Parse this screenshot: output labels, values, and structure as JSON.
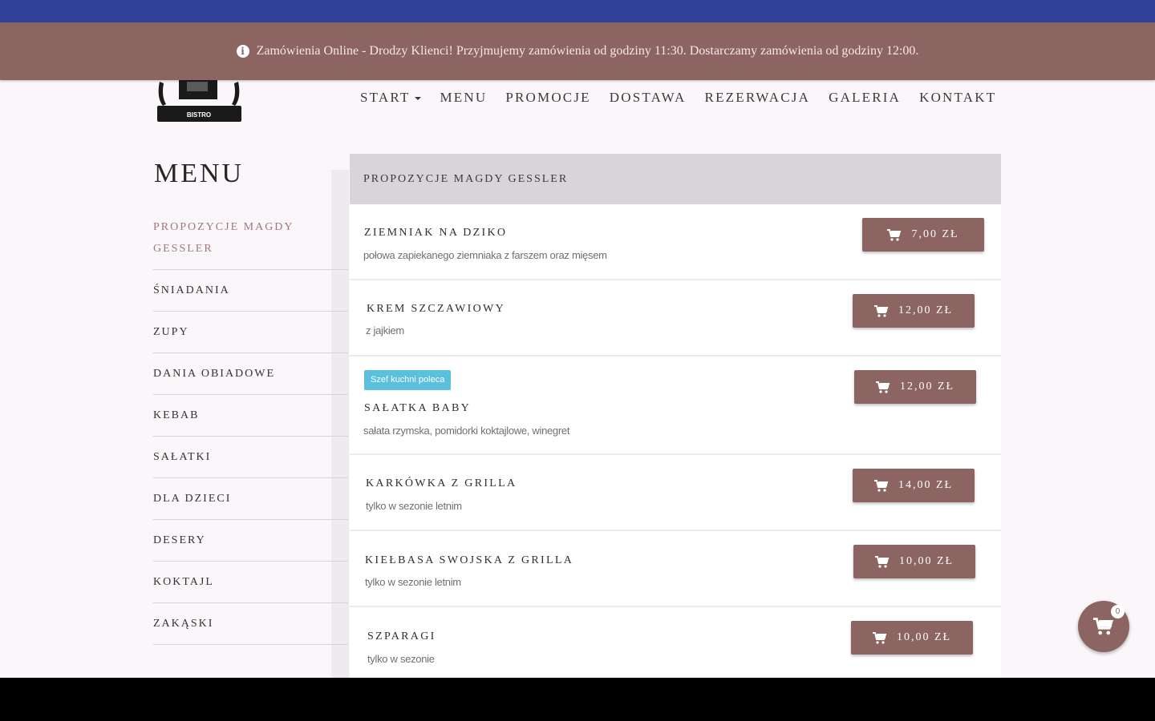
{
  "notice": {
    "text": "Zamówienia Online - Drodzy Klienci! Przyjmujemy zamówienia od godziny 11:30. Dostarczamy zamówienia od godziny 12:00.",
    "icon": "info-icon"
  },
  "logo": {
    "label": "BISTRO"
  },
  "nav": {
    "items": [
      "START",
      "MENU",
      "PROMOCJE",
      "DOSTAWA",
      "REZERWACJA",
      "GALERIA",
      "KONTAKT"
    ]
  },
  "page_title": "MENU",
  "sidebar": {
    "items": [
      "PROPOZYCJE MAGDY GESSLER",
      "ŚNIADANIA",
      "ZUPY",
      "DANIA OBIADOWE",
      "KEBAB",
      "SAŁATKI",
      "DLA DZIECI",
      "DESERY",
      "KOKTAJL",
      "ZAKĄSKI"
    ]
  },
  "category": {
    "title": "PROPOZYCJE MAGDY GESSLER"
  },
  "items": [
    {
      "name": "ZIEMNIAK NA DZIKO",
      "desc": "połowa zapiekanego ziemniaka z farszem oraz mięsem",
      "price": "7,00 ZŁ",
      "badge": ""
    },
    {
      "name": "KREM SZCZAWIOWY",
      "desc": "z jajkiem",
      "price": "12,00 ZŁ",
      "badge": ""
    },
    {
      "name": "SAŁATKA BABY",
      "desc": "sałata rzymska, pomidorki koktajlowe, winegret",
      "price": "12,00 ZŁ",
      "badge": "Szef kuchni poleca"
    },
    {
      "name": "KARKÓWKA Z GRILLA",
      "desc": "tylko w sezonie letnim",
      "price": "14,00 ZŁ",
      "badge": ""
    },
    {
      "name": "KIEŁBASA SWOJSKA Z GRILLA",
      "desc": "tylko w sezonie letnim",
      "price": "10,00 ZŁ",
      "badge": ""
    },
    {
      "name": "SZPARAGI",
      "desc": "tylko w sezonie",
      "price": "10,00 ZŁ",
      "badge": ""
    }
  ],
  "cart": {
    "count": "0",
    "icon": "cart-icon"
  },
  "colors": {
    "accent": "#8c6462",
    "topbar": "#31409a",
    "badge": "#5bc0de"
  }
}
